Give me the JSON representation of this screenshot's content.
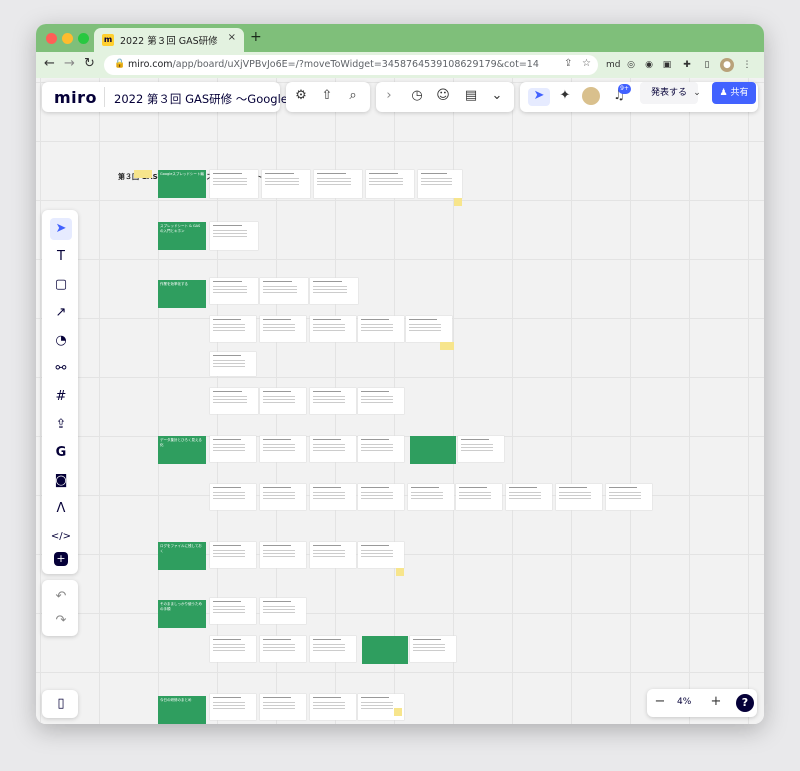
{
  "browser": {
    "tab_title": "2022 第３回 GAS研修 〜Googl...",
    "tab_close": "×",
    "new_tab": "+",
    "url_host": "miro.com",
    "url_path": "/app/board/uXjVPBvJo6E=/?moveToWidget=3458764539108629179&cot=14",
    "favicon": "m"
  },
  "miro": {
    "logo": "miro",
    "board_title": "2022 第３回 GAS研修 〜Google...",
    "present_label": "発表する",
    "share_label": "共有",
    "notification_badge": "9+",
    "zoom_level": "4%",
    "zoom_out": "−",
    "zoom_in": "+",
    "help": "?",
    "canvas_title": "第３回 GAS研修 〜Googeスプレッドシート編〜"
  },
  "sections": [
    {
      "label": "Googleスプレッドシート編"
    },
    {
      "label": "スプレッドシート & GAS の入門とキホン"
    },
    {
      "label": "作業を効率化する"
    },
    {
      "label": "データ集計とひろく見える化"
    },
    {
      "label": "ログをファイルに残しておく"
    },
    {
      "label": "そのまましっかり使うための手順"
    },
    {
      "label": "今日の研修のまとめ"
    }
  ],
  "icons": {
    "back": "back-arrow-icon",
    "forward": "forward-arrow-icon",
    "reload": "reload-icon",
    "settings": "gear-icon",
    "upload": "upload-icon",
    "search": "search-icon"
  },
  "colors": {
    "tabbar": "#7fbf7a",
    "section": "#2f9e5f",
    "share": "#4262ff",
    "miro_dark": "#050038"
  }
}
